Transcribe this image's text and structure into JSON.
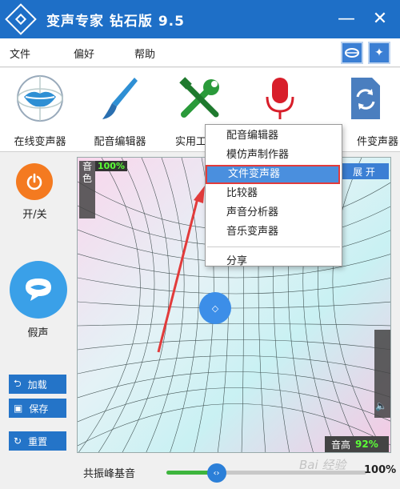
{
  "window": {
    "title": "变声专家 钻石版 9.5",
    "minimize": "—",
    "close": "✕"
  },
  "menu": {
    "items": [
      "文件",
      "偏好",
      "帮助"
    ]
  },
  "toolbar": {
    "items": [
      {
        "label": "在线变声器",
        "icon": "lips-icon"
      },
      {
        "label": "配音编辑器",
        "icon": "brush-icon"
      },
      {
        "label": "实用工",
        "icon": "tools-icon"
      },
      {
        "label": "",
        "icon": "microphone-icon"
      },
      {
        "label": "件变声器",
        "icon": "file-convert-icon"
      }
    ]
  },
  "left": {
    "power_label": "开/关",
    "fake_label": "假声",
    "load": "加载",
    "save": "保存",
    "reset": "重置"
  },
  "pad": {
    "timbre_label": "音色",
    "timbre_value": "100%",
    "expand": "展 开",
    "pitch_label": "音高",
    "pitch_value": "92%"
  },
  "slider": {
    "label": "共振峰基音",
    "value_text": "100%",
    "value": 0.25
  },
  "dropdown": {
    "items": [
      "配音编辑器",
      "模仿声制作器",
      "文件变声器",
      "比较器",
      "声音分析器",
      "音乐变声器"
    ],
    "share": "分享",
    "active_index": 2
  },
  "watermark": "Bai 经验",
  "colors": {
    "accent": "#1e6fc7",
    "highlight": "#e23b3b",
    "pct_green": "#5cff37"
  }
}
